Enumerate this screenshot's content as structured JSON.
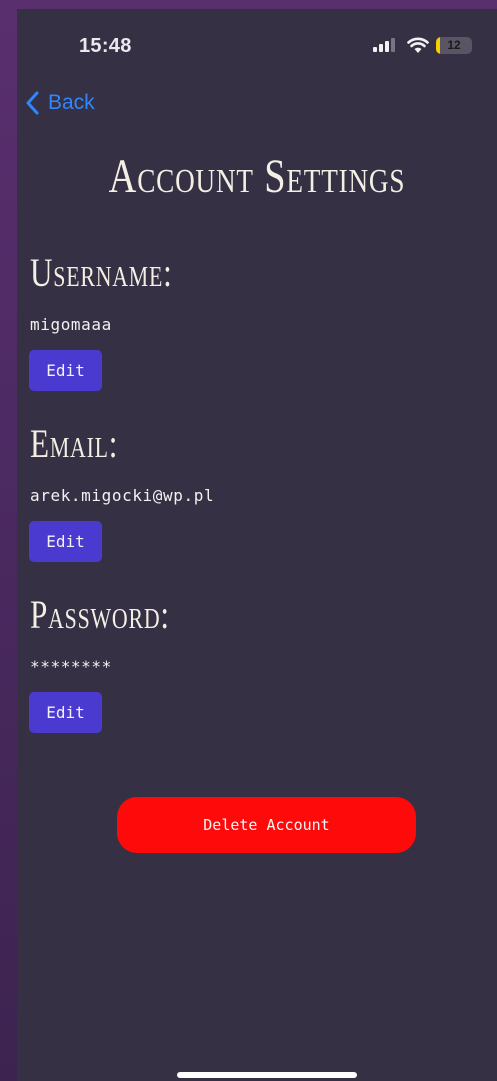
{
  "status_bar": {
    "time": "15:48",
    "battery_level": "12",
    "battery_fraction": 0.12,
    "battery_color": "#f5d000"
  },
  "nav": {
    "back_label": "Back",
    "back_icon": "chevron-left-icon",
    "accent_color": "#2f86ff"
  },
  "page": {
    "title": "Account Settings"
  },
  "sections": [
    {
      "heading": "Username:",
      "value": "migomaaa",
      "edit_label": "Edit"
    },
    {
      "heading": "Email:",
      "value": "arek.migocki@wp.pl",
      "edit_label": "Edit"
    },
    {
      "heading": "Password:",
      "value": "********",
      "edit_label": "Edit"
    }
  ],
  "delete": {
    "label": "Delete Account",
    "color": "#ff0a0a"
  },
  "theme": {
    "background": "#353043",
    "edit_button_color": "#4a3ad0"
  }
}
